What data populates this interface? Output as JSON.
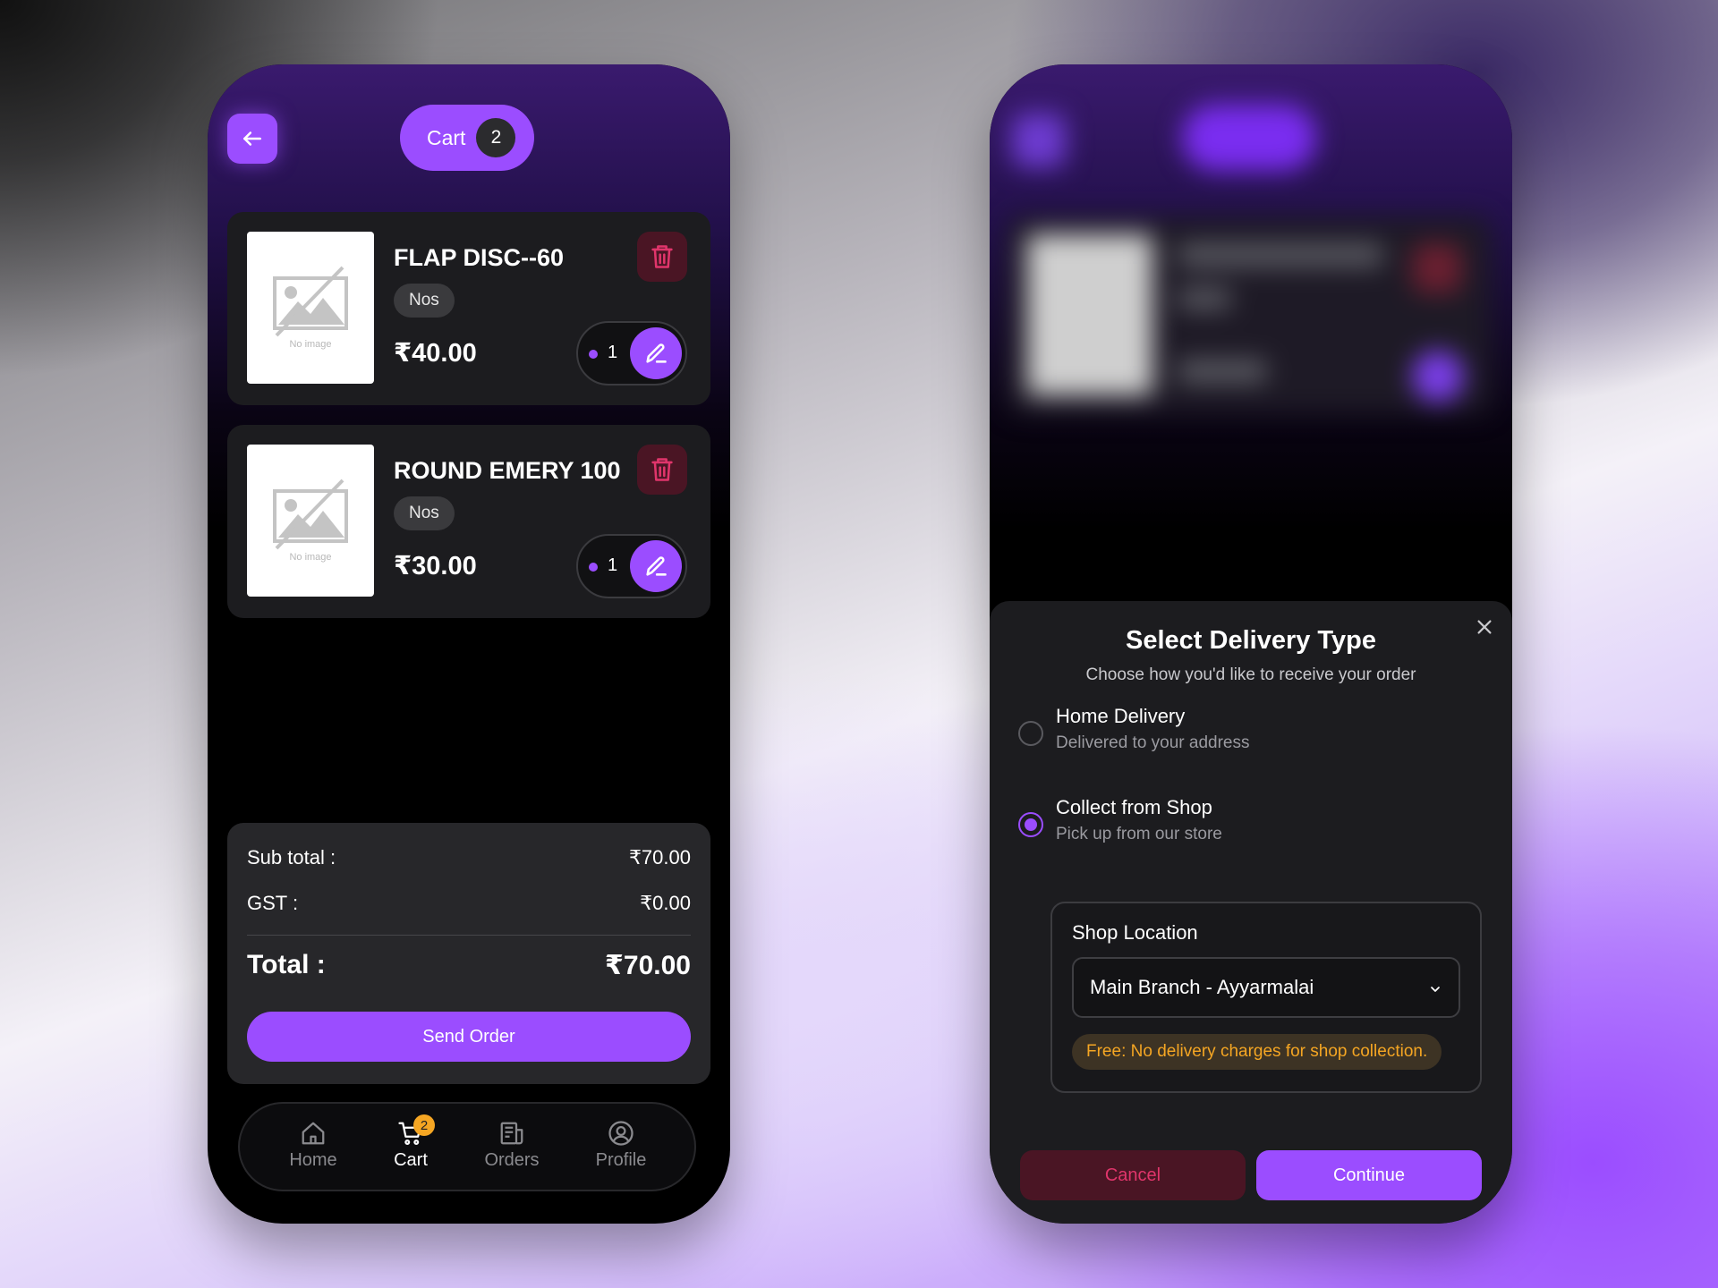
{
  "colors": {
    "accent": "#9b4dff",
    "danger": "#e0356b",
    "badge": "#f5a623",
    "surface": "#1c1c1f",
    "background": "#000000"
  },
  "header": {
    "back_icon": "arrow-left-icon",
    "cart_label": "Cart",
    "cart_count": "2"
  },
  "cart_items": [
    {
      "name": "FLAP DISC--60",
      "unit": "Nos",
      "price": "₹40.00",
      "quantity": "1",
      "image_caption": "No image",
      "delete_icon": "trash-icon",
      "edit_icon": "pencil-icon"
    },
    {
      "name": "ROUND EMERY 100",
      "unit": "Nos",
      "price": "₹30.00",
      "quantity": "1",
      "image_caption": "No image",
      "delete_icon": "trash-icon",
      "edit_icon": "pencil-icon"
    }
  ],
  "summary": {
    "subtotal_label": "Sub total :",
    "subtotal_value": "₹70.00",
    "gst_label": "GST :",
    "gst_value": "₹0.00",
    "total_label": "Total :",
    "total_value": "₹70.00",
    "send_label": "Send Order"
  },
  "bottom_nav": {
    "items": [
      {
        "label": "Home",
        "icon": "home-icon"
      },
      {
        "label": "Cart",
        "icon": "cart-icon",
        "badge": "2",
        "active": true
      },
      {
        "label": "Orders",
        "icon": "orders-icon"
      },
      {
        "label": "Profile",
        "icon": "profile-icon"
      }
    ]
  },
  "delivery_sheet": {
    "title": "Select Delivery Type",
    "subtitle": "Choose how you'd like to receive your order",
    "close_icon": "close-icon",
    "options": [
      {
        "title": "Home Delivery",
        "description": "Delivered to your address",
        "selected": false
      },
      {
        "title": "Collect from Shop",
        "description": "Pick up from our store",
        "selected": true
      }
    ],
    "shop_location_label": "Shop Location",
    "shop_location_value": "Main Branch - Ayyarmalai",
    "free_note": "Free: No delivery charges for shop collection.",
    "cancel_label": "Cancel",
    "continue_label": "Continue"
  }
}
